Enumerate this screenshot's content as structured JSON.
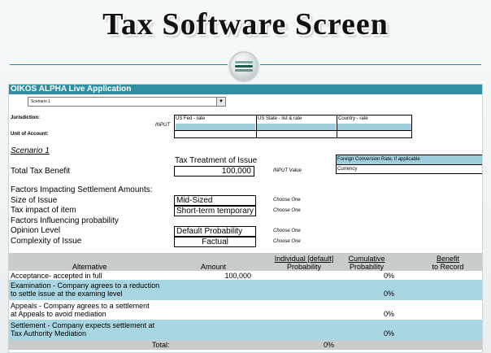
{
  "page_title": "Tax Software Screen",
  "app": {
    "title": "OIKOS ALPHA Live Application",
    "scenario_select": {
      "selected": "Scenario 1"
    }
  },
  "jurisdiction": {
    "label": "Jurisdiction:",
    "input_hint": "INPUT",
    "columns": [
      "US Fed - rate",
      "US State - list & rate",
      "Country - rate"
    ],
    "unit_label": "Unit of Account:"
  },
  "scenario": {
    "heading": "Scenario 1",
    "tax_treatment_label": "Tax Treatment of Issue",
    "total_benefit_label": "Total Tax Benefit",
    "total_benefit_value": "100,000",
    "input_value_hint": "INPUT Value",
    "foreign_rate_label": "Foreign Conversion Rate, if applicable",
    "currency_label": "Currency"
  },
  "factors": {
    "settlement_heading": "Factors Impacting Settlement Amounts:",
    "size_label": "Size of Issue",
    "size_value": "Mid-Sized",
    "impact_label": "Tax impact of item",
    "impact_value": "Short-term temporary",
    "probability_heading": "Factors Influencing probability",
    "opinion_label": "Opinion Level",
    "opinion_value": "Default Probability",
    "complexity_label": "Complexity of Issue",
    "complexity_value": "Factual",
    "choose_hint": "Choose One"
  },
  "table": {
    "headers": {
      "alternative": "Alternative",
      "amount": "Amount",
      "individual_line1": "Individual [default]",
      "individual_line2": "Probability",
      "cumulative_line1": "Cumulative",
      "cumulative_line2": "Probability",
      "benefit_line1": "Benefit",
      "benefit_line2": "to Record"
    },
    "rows": [
      {
        "line1": "Acceptance- accepted in full",
        "line2": "",
        "amount": "100,000",
        "cumulative": "0%"
      },
      {
        "line1": "Examination - Company agrees to a reduction",
        "line2": "to settle issue at the examing level",
        "amount": "",
        "cumulative": "0%"
      },
      {
        "line1": "Appeals - Company agrees to a settlement",
        "line2": "at Appeals to avoid mediation",
        "amount": "",
        "cumulative": "0%"
      },
      {
        "line1": "Settlement - Company expects settlement at",
        "line2": "Tax Authority Mediation",
        "amount": "",
        "cumulative": "0%"
      }
    ],
    "total_label": "Total:",
    "total_value": "0%"
  },
  "colors": {
    "appbar": "#2f8fa1",
    "input_cell": "#9fcfdd",
    "header_row": "#c9cccc",
    "rule": "#3a7f88"
  }
}
